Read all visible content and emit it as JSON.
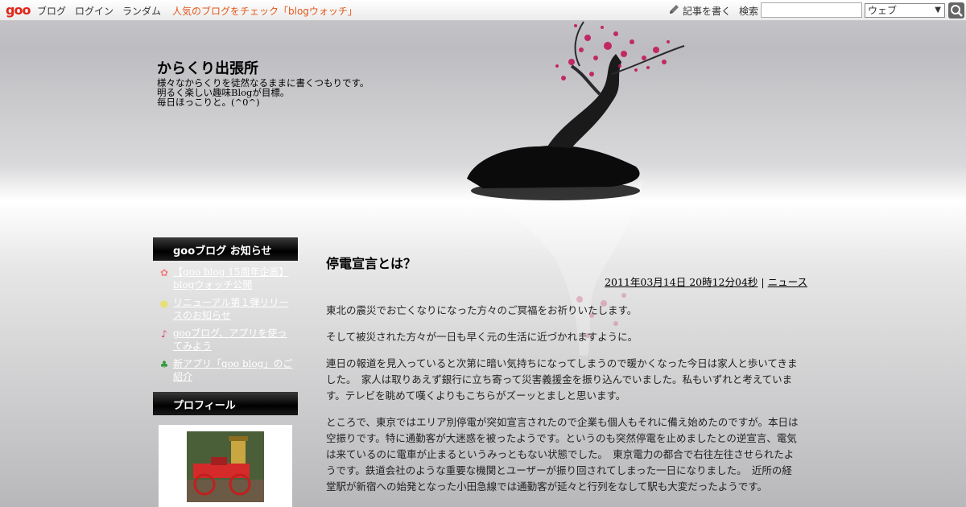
{
  "toolbar": {
    "logo": "goo",
    "links": [
      "ブログ",
      "ログイン",
      "ランダム"
    ],
    "watch": "人気のブログをチェック「blogウォッチ」",
    "write": "記事を書く",
    "search_label": "検索",
    "search_value": "",
    "search_scope": "ウェブ"
  },
  "header": {
    "title": "からくり出張所",
    "desc": [
      "様々なからくりを徒然なるままに書くつもりです。",
      "明るく楽しい趣味Blogが目標。",
      "毎日ほっこりと。(^0^)"
    ]
  },
  "sidebar": {
    "notice_heading": "gooブログ お知らせ",
    "notices": [
      {
        "icon": "flower-icon",
        "label": "【goo blog 15周年企画】blogウォッチ公開"
      },
      {
        "icon": "lightbulb-icon",
        "label": "リニューアル第１弾リリースのお知らせ"
      },
      {
        "icon": "music-note-icon",
        "label": "gooブログ、アプリを使ってみよう"
      },
      {
        "icon": "clover-icon",
        "label": "新アプリ「goo blog」のご紹介"
      }
    ],
    "profile_heading": "プロフィール"
  },
  "post": {
    "title": "停電宣言とは？",
    "date": "2011年03月14日 20時12分04秒",
    "separator": "|",
    "category": "ニュース",
    "paragraphs": [
      "東北の震災でお亡くなりになった方々のご冥福をお祈りいたします。",
      "そして被災された方々が一日も早く元の生活に近づかれますように。",
      "連日の報道を見入っていると次第に暗い気持ちになってしまうので暖かくなった今日は家人と歩いてきました。　家人は取りあえず銀行に立ち寄って災害義援金を振り込んでいました。私もいずれと考えています。テレビを眺めて嘆くよりもこちらがズーッとましと思います。",
      "ところで、東京ではエリア別停電が突如宣言されたので企業も個人もそれに備え始めたのですが。本日は空振りです。特に通勤客が大迷惑を被ったようです。というのも突然停電を止めましたとの逆宣言、電気は来ているのに電車が止まるというみっともない状態でした。　東京電力の都合で右往左往させられたようです。鉄道会社のような重要な機関とユーザーが振り回されてしまった一日になりました。　近所の経堂駅が新宿への始発となった小田急線では通勤客が延々と行列をなして駅も大変だったようです。"
    ]
  },
  "colors": {
    "accent": "#e2571a",
    "logo": "#e2231a",
    "blossom": "#c2185b"
  }
}
